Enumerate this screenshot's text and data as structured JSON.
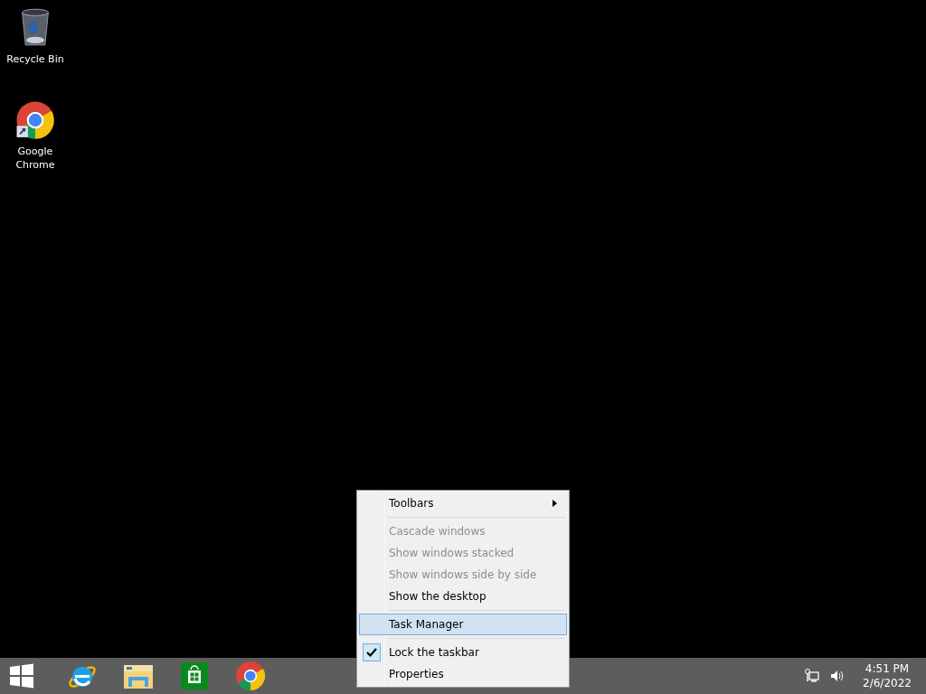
{
  "desktop_icons": [
    {
      "label": "Recycle Bin",
      "kind": "recycle"
    },
    {
      "label": "Google Chrome",
      "kind": "chrome"
    }
  ],
  "context_menu": {
    "items": [
      {
        "kind": "item",
        "label": "Toolbars",
        "disabled": false,
        "selected": false,
        "checked": false,
        "submenu": true
      },
      {
        "kind": "separator"
      },
      {
        "kind": "item",
        "label": "Cascade windows",
        "disabled": true,
        "selected": false,
        "checked": false,
        "submenu": false
      },
      {
        "kind": "item",
        "label": "Show windows stacked",
        "disabled": true,
        "selected": false,
        "checked": false,
        "submenu": false
      },
      {
        "kind": "item",
        "label": "Show windows side by side",
        "disabled": true,
        "selected": false,
        "checked": false,
        "submenu": false
      },
      {
        "kind": "item",
        "label": "Show the desktop",
        "disabled": false,
        "selected": false,
        "checked": false,
        "submenu": false
      },
      {
        "kind": "separator"
      },
      {
        "kind": "item",
        "label": "Task Manager",
        "disabled": false,
        "selected": true,
        "checked": false,
        "submenu": false
      },
      {
        "kind": "separator"
      },
      {
        "kind": "item",
        "label": "Lock the taskbar",
        "disabled": false,
        "selected": false,
        "checked": true,
        "submenu": false
      },
      {
        "kind": "item",
        "label": "Properties",
        "disabled": false,
        "selected": false,
        "checked": false,
        "submenu": false
      }
    ]
  },
  "taskbar": {
    "apps": [
      {
        "kind": "start"
      },
      {
        "kind": "ie"
      },
      {
        "kind": "explorer"
      },
      {
        "kind": "store"
      },
      {
        "kind": "chrome"
      }
    ],
    "clock": {
      "time": "4:51 PM",
      "date": "2/6/2022"
    }
  }
}
